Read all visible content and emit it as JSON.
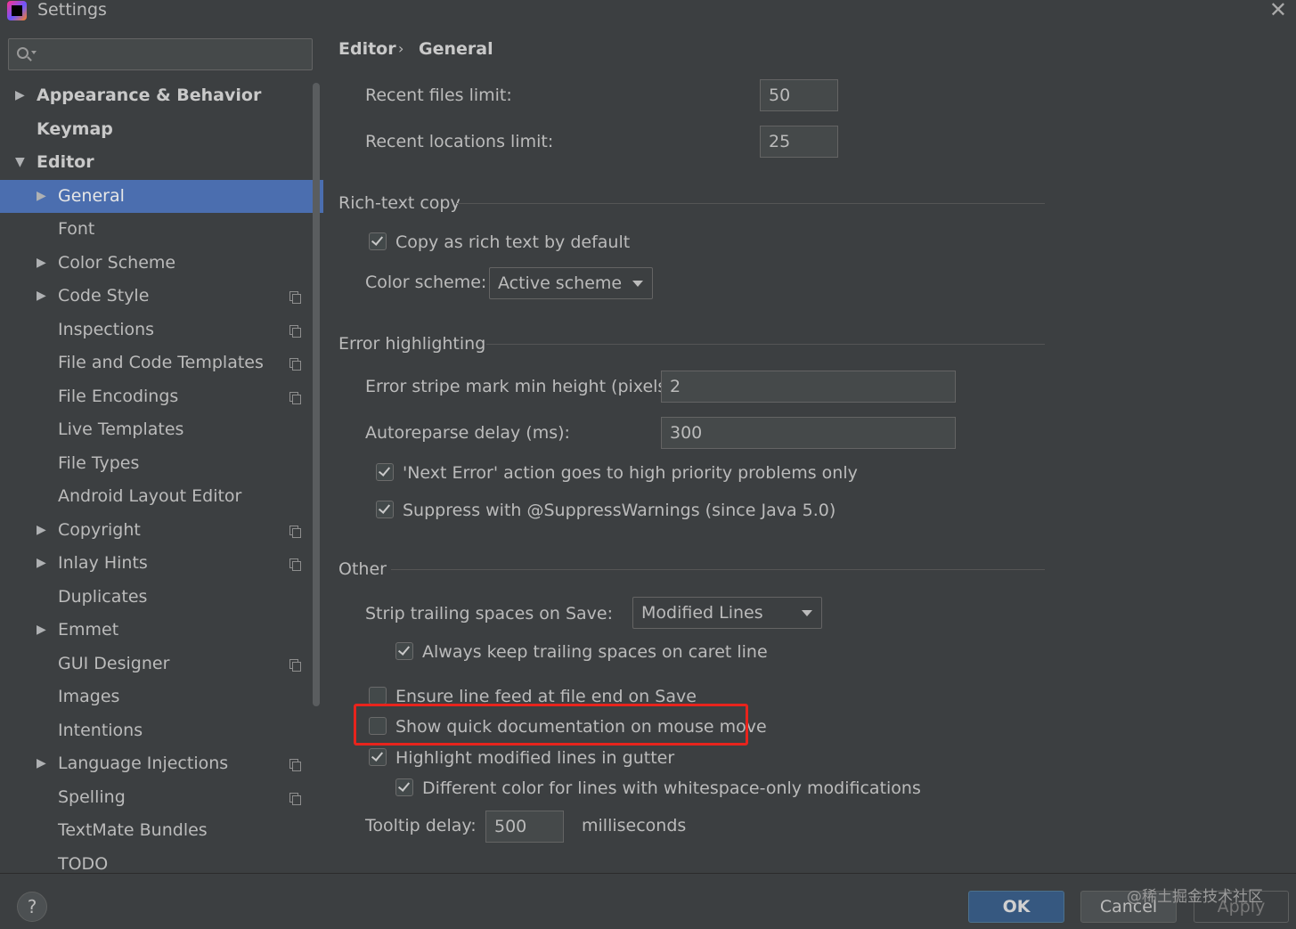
{
  "window": {
    "title": "Settings"
  },
  "search": {
    "placeholder": ""
  },
  "tree": [
    {
      "label": "Appearance & Behavior",
      "level": 0,
      "arrow": "▶",
      "bold": true,
      "selected": false,
      "project_icon": false
    },
    {
      "label": "Keymap",
      "level": 0,
      "arrow": "",
      "bold": true,
      "selected": false,
      "project_icon": false
    },
    {
      "label": "Editor",
      "level": 0,
      "arrow": "▼",
      "bold": true,
      "selected": false,
      "project_icon": false
    },
    {
      "label": "General",
      "level": 1,
      "arrow": "▶",
      "bold": false,
      "selected": true,
      "project_icon": false
    },
    {
      "label": "Font",
      "level": 1,
      "arrow": "",
      "bold": false,
      "selected": false,
      "project_icon": false
    },
    {
      "label": "Color Scheme",
      "level": 1,
      "arrow": "▶",
      "bold": false,
      "selected": false,
      "project_icon": false
    },
    {
      "label": "Code Style",
      "level": 1,
      "arrow": "▶",
      "bold": false,
      "selected": false,
      "project_icon": true
    },
    {
      "label": "Inspections",
      "level": 1,
      "arrow": "",
      "bold": false,
      "selected": false,
      "project_icon": true
    },
    {
      "label": "File and Code Templates",
      "level": 1,
      "arrow": "",
      "bold": false,
      "selected": false,
      "project_icon": true
    },
    {
      "label": "File Encodings",
      "level": 1,
      "arrow": "",
      "bold": false,
      "selected": false,
      "project_icon": true
    },
    {
      "label": "Live Templates",
      "level": 1,
      "arrow": "",
      "bold": false,
      "selected": false,
      "project_icon": false
    },
    {
      "label": "File Types",
      "level": 1,
      "arrow": "",
      "bold": false,
      "selected": false,
      "project_icon": false
    },
    {
      "label": "Android Layout Editor",
      "level": 1,
      "arrow": "",
      "bold": false,
      "selected": false,
      "project_icon": false
    },
    {
      "label": "Copyright",
      "level": 1,
      "arrow": "▶",
      "bold": false,
      "selected": false,
      "project_icon": true
    },
    {
      "label": "Inlay Hints",
      "level": 1,
      "arrow": "▶",
      "bold": false,
      "selected": false,
      "project_icon": true
    },
    {
      "label": "Duplicates",
      "level": 1,
      "arrow": "",
      "bold": false,
      "selected": false,
      "project_icon": false
    },
    {
      "label": "Emmet",
      "level": 1,
      "arrow": "▶",
      "bold": false,
      "selected": false,
      "project_icon": false
    },
    {
      "label": "GUI Designer",
      "level": 1,
      "arrow": "",
      "bold": false,
      "selected": false,
      "project_icon": true
    },
    {
      "label": "Images",
      "level": 1,
      "arrow": "",
      "bold": false,
      "selected": false,
      "project_icon": false
    },
    {
      "label": "Intentions",
      "level": 1,
      "arrow": "",
      "bold": false,
      "selected": false,
      "project_icon": false
    },
    {
      "label": "Language Injections",
      "level": 1,
      "arrow": "▶",
      "bold": false,
      "selected": false,
      "project_icon": true
    },
    {
      "label": "Spelling",
      "level": 1,
      "arrow": "",
      "bold": false,
      "selected": false,
      "project_icon": true
    },
    {
      "label": "TextMate Bundles",
      "level": 1,
      "arrow": "",
      "bold": false,
      "selected": false,
      "project_icon": false
    },
    {
      "label": "TODO",
      "level": 1,
      "arrow": "",
      "bold": false,
      "selected": false,
      "project_icon": false
    }
  ],
  "breadcrumb": {
    "parent": "Editor",
    "separator": "›",
    "current": "General"
  },
  "general": {
    "recent_files_label": "Recent files limit:",
    "recent_files_value": "50",
    "recent_locations_label": "Recent locations limit:",
    "recent_locations_value": "25"
  },
  "rich_text": {
    "title": "Rich-text copy",
    "copy_label": "Copy as rich text by default",
    "copy_checked": true,
    "scheme_label": "Color scheme:",
    "scheme_value": "Active scheme"
  },
  "error_highlighting": {
    "title": "Error highlighting",
    "stripe_label": "Error stripe mark min height (pixels):",
    "stripe_value": "2",
    "autoreparse_label": "Autoreparse delay (ms):",
    "autoreparse_value": "300",
    "next_error_label": "'Next Error' action goes to high priority problems only",
    "next_error_checked": true,
    "suppress_label": "Suppress with @SuppressWarnings (since Java 5.0)",
    "suppress_checked": true
  },
  "other": {
    "title": "Other",
    "strip_label": "Strip trailing spaces on Save:",
    "strip_value": "Modified Lines",
    "keep_caret_label": "Always keep trailing spaces on caret line",
    "keep_caret_checked": true,
    "line_feed_label": "Ensure line feed at file end on Save",
    "line_feed_checked": false,
    "quick_doc_label": "Show quick documentation on mouse move",
    "quick_doc_checked": false,
    "highlight_modified_label": "Highlight modified lines in gutter",
    "highlight_modified_checked": true,
    "whitespace_color_label": "Different color for lines with whitespace-only modifications",
    "whitespace_color_checked": true,
    "tooltip_label": "Tooltip delay:",
    "tooltip_value": "500",
    "tooltip_unit": "milliseconds"
  },
  "footer": {
    "help_label": "?",
    "ok_label": "OK",
    "cancel_label": "Cancel",
    "apply_label": "Apply",
    "watermark": "@稀土掘金技术社区"
  },
  "colors": {
    "background": "#3c3f41",
    "selection": "#4b6eaf",
    "highlight_box": "#e8241c",
    "ok_button": "#365880"
  }
}
